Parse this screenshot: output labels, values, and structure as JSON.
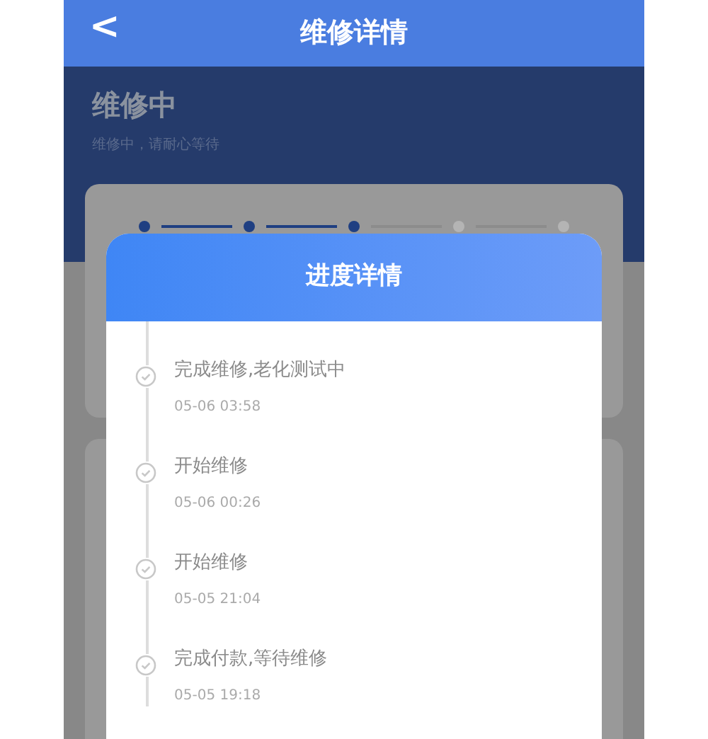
{
  "header": {
    "back": "<",
    "title": "维修详情"
  },
  "status": {
    "title": "维修中",
    "subtitle": "维修中，请耐心等待"
  },
  "steps": [
    {
      "done": true
    },
    {
      "done": true
    },
    {
      "done": true
    },
    {
      "done": false
    },
    {
      "done": false
    }
  ],
  "dialog": {
    "title": "进度详情",
    "events": [
      {
        "text": "完成维修,老化测试中",
        "time": "05-06 03:58"
      },
      {
        "text": "开始维修",
        "time": "05-06 00:26"
      },
      {
        "text": "开始维修",
        "time": "05-05 21:04"
      },
      {
        "text": "完成付款,等待维修",
        "time": "05-05 19:18"
      }
    ]
  }
}
